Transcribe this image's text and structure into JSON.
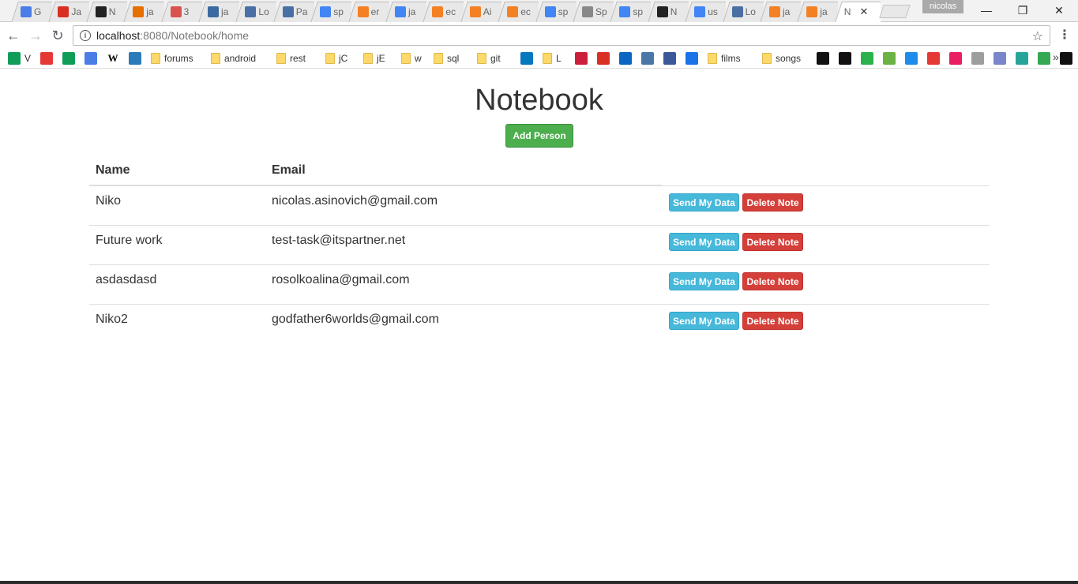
{
  "browser": {
    "tabs": [
      {
        "title": "G",
        "favicon": "google-translate-icon",
        "color": "#4a7de6"
      },
      {
        "title": "Ja",
        "favicon": "gmail-icon",
        "color": "#d93025"
      },
      {
        "title": "N",
        "favicon": "github-icon",
        "color": "#222222"
      },
      {
        "title": "ja",
        "favicon": "java-icon",
        "color": "#e76f00"
      },
      {
        "title": "3",
        "favicon": "hexlet-icon",
        "color": "#d9534f"
      },
      {
        "title": "ja",
        "favicon": "stackoverflow-icon",
        "color": "#3b6aa0"
      },
      {
        "title": "Lo",
        "favicon": "jrebel-icon",
        "color": "#4a6fa5"
      },
      {
        "title": "Pa",
        "favicon": "jrebel-icon",
        "color": "#4a6fa5"
      },
      {
        "title": "sp",
        "favicon": "google-icon",
        "color": "#4285f4"
      },
      {
        "title": "er",
        "favicon": "stackoverflow-icon",
        "color": "#f48024"
      },
      {
        "title": "ja",
        "favicon": "google-icon",
        "color": "#4285f4"
      },
      {
        "title": "ec",
        "favicon": "stackoverflow-icon",
        "color": "#f48024"
      },
      {
        "title": "Ai",
        "favicon": "stackoverflow-icon",
        "color": "#f48024"
      },
      {
        "title": "ec",
        "favicon": "stackoverflow-icon",
        "color": "#f48024"
      },
      {
        "title": "sp",
        "favicon": "google-icon",
        "color": "#4285f4"
      },
      {
        "title": "Sp",
        "favicon": "document-icon",
        "color": "#888888"
      },
      {
        "title": "sp",
        "favicon": "google-icon",
        "color": "#4285f4"
      },
      {
        "title": "N",
        "favicon": "github-icon",
        "color": "#222222"
      },
      {
        "title": "us",
        "favicon": "google-icon",
        "color": "#4285f4"
      },
      {
        "title": "Lo",
        "favicon": "jrebel-icon",
        "color": "#4a6fa5"
      },
      {
        "title": "ja",
        "favicon": "stackoverflow-icon",
        "color": "#f48024"
      },
      {
        "title": "ja",
        "favicon": "stackoverflow-icon",
        "color": "#f48024"
      },
      {
        "title": "N",
        "favicon": "none",
        "color": "#ffffff",
        "active": true
      }
    ],
    "profile_name": "nicolas",
    "url_host": "localhost",
    "url_path": ":8080/Notebook/home",
    "bookmarks": [
      {
        "label": "V",
        "icon": "sheets-icon",
        "color": "#0f9d58"
      },
      {
        "label": "",
        "icon": "lingualeo-icon",
        "color": "#e53935"
      },
      {
        "label": "",
        "icon": "sheets-icon",
        "color": "#0f9d58"
      },
      {
        "label": "",
        "icon": "google-translate-icon",
        "color": "#4a7de6"
      },
      {
        "label": "W",
        "icon": "wikipedia-icon",
        "color": "#ffffff"
      },
      {
        "label": "",
        "icon": "edge-icon",
        "color": "#2b7bb9"
      },
      {
        "label": "forums",
        "icon": "folder-icon"
      },
      {
        "label": "android",
        "icon": "folder-icon"
      },
      {
        "label": "rest",
        "icon": "folder-icon"
      },
      {
        "label": "jC",
        "icon": "folder-icon"
      },
      {
        "label": "jE",
        "icon": "folder-icon"
      },
      {
        "label": "w",
        "icon": "folder-icon"
      },
      {
        "label": "sql",
        "icon": "folder-icon"
      },
      {
        "label": "git",
        "icon": "folder-icon"
      },
      {
        "label": "",
        "icon": "drupal-icon",
        "color": "#0678be"
      },
      {
        "label": "L",
        "icon": "folder-icon"
      },
      {
        "label": "",
        "icon": "pocket-icon",
        "color": "#cc1f3b"
      },
      {
        "label": "",
        "icon": "gmail-icon",
        "color": "#d93025"
      },
      {
        "label": "",
        "icon": "linkedin-icon",
        "color": "#0a66c2"
      },
      {
        "label": "",
        "icon": "vk-icon",
        "color": "#4a76a8"
      },
      {
        "label": "",
        "icon": "facebook-icon",
        "color": "#3b5998"
      },
      {
        "label": "",
        "icon": "calendar-icon",
        "color": "#1a73e8"
      },
      {
        "label": "films",
        "icon": "folder-icon"
      },
      {
        "label": "songs",
        "icon": "folder-icon"
      },
      {
        "label": "",
        "icon": "jr-icon",
        "color": "#111111"
      },
      {
        "label": "",
        "icon": "jr-icon",
        "color": "#111111"
      },
      {
        "label": "",
        "icon": "feedly-icon",
        "color": "#2bb24c"
      },
      {
        "label": "",
        "icon": "android-icon",
        "color": "#6ab344"
      },
      {
        "label": "",
        "icon": "d-icon",
        "color": "#1f8ceb"
      },
      {
        "label": "",
        "icon": "i-icon",
        "color": "#e53935"
      },
      {
        "label": "",
        "icon": "flag-icon",
        "color": "#e91e63"
      },
      {
        "label": "",
        "icon": "brain-icon",
        "color": "#9e9e9e"
      },
      {
        "label": "",
        "icon": "test-icon",
        "color": "#7986cb"
      },
      {
        "label": "",
        "icon": "tree-icon",
        "color": "#26a69a"
      },
      {
        "label": "",
        "icon": "maps-icon",
        "color": "#34a853"
      },
      {
        "label": "",
        "icon": "heart-icon",
        "color": "#111111"
      }
    ]
  },
  "page": {
    "title": "Notebook",
    "add_button": "Add Person",
    "columns": [
      "Name",
      "Email",
      ""
    ],
    "rows": [
      {
        "name": "Niko",
        "email": "nicolas.asinovich@gmail.com",
        "send": "Send My Data",
        "delete": "Delete Note"
      },
      {
        "name": "Future work",
        "email": "test-task@itspartner.net",
        "send": "Send My Data",
        "delete": "Delete Note"
      },
      {
        "name": "asdasdasd",
        "email": "rosolkoalina@gmail.com",
        "send": "Send My Data",
        "delete": "Delete Note"
      },
      {
        "name": "Niko2",
        "email": "godfather6worlds@gmail.com",
        "send": "Send My Data",
        "delete": "Delete Note"
      }
    ]
  },
  "colors": {
    "success": "#4cae4c",
    "info": "#46b8da",
    "danger": "#d43f3a"
  }
}
